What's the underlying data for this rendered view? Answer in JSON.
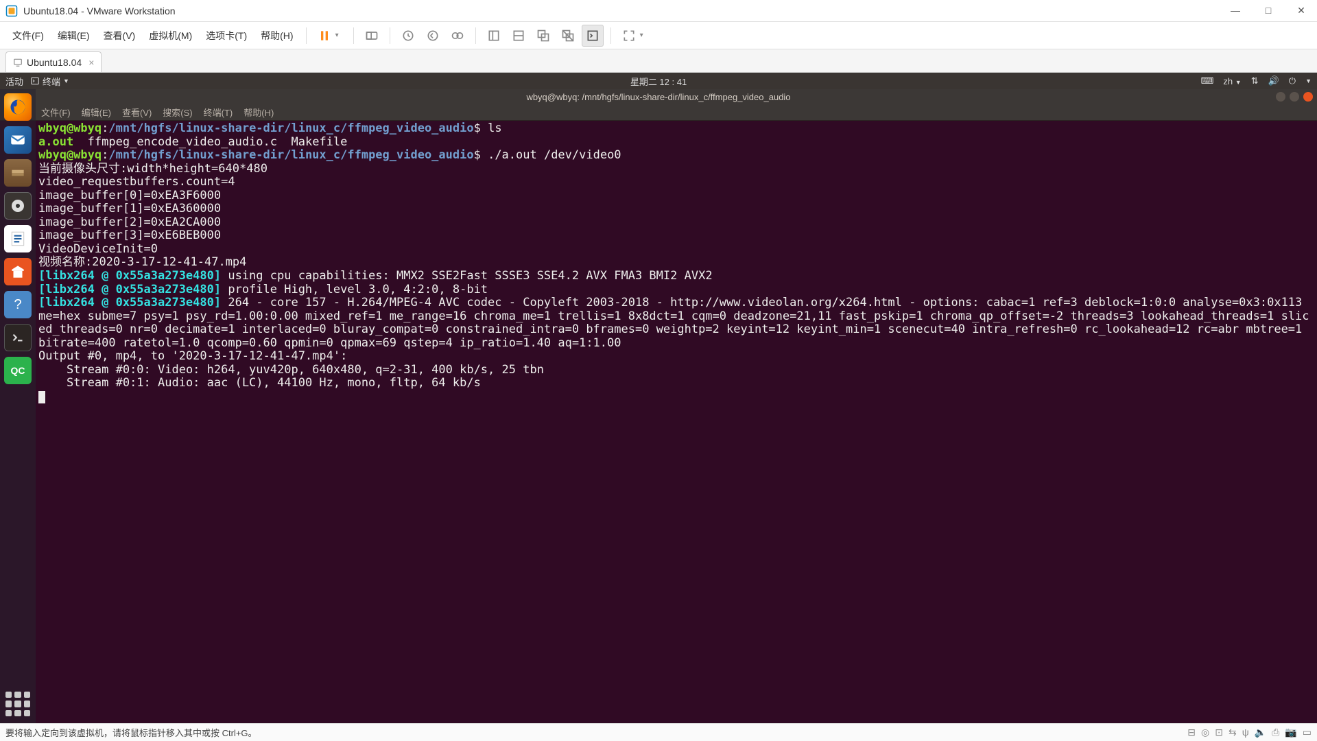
{
  "vmware": {
    "title": "Ubuntu18.04 - VMware Workstation",
    "menu": [
      "文件(F)",
      "编辑(E)",
      "查看(V)",
      "虚拟机(M)",
      "选项卡(T)",
      "帮助(H)"
    ],
    "tab": "Ubuntu18.04",
    "status": "要将输入定向到该虚拟机，请将鼠标指针移入其中或按 Ctrl+G。"
  },
  "ubuntu": {
    "activities": "活动",
    "term_label": "终端",
    "clock": "星期二 12 : 41",
    "lang": "zh",
    "term_title": "wbyq@wbyq: /mnt/hgfs/linux-share-dir/linux_c/ffmpeg_video_audio",
    "term_menu": [
      "文件(F)",
      "编辑(E)",
      "查看(V)",
      "搜索(S)",
      "终端(T)",
      "帮助(H)"
    ]
  },
  "shell": {
    "user": "wbyq@wbyq",
    "path": "/mnt/hgfs/linux-share-dir/linux_c/ffmpeg_video_audio",
    "ls_cmd": "ls",
    "ls_aout": "a.out",
    "ls_cfile": "ffmpeg_encode_video_audio.c",
    "ls_make": "Makefile",
    "run_cmd": "./a.out /dev/video0",
    "dim": "当前摄像头尺寸:width*height=640*480",
    "reqbuf": "video_requestbuffers.count=4",
    "ib0": "image_buffer[0]=0xEA3F6000",
    "ib1": "image_buffer[1]=0xEA360000",
    "ib2": "image_buffer[2]=0xEA2CA000",
    "ib3": "image_buffer[3]=0xE6BEB000",
    "vdi": "VideoDeviceInit=0",
    "vname": "视频名称:2020-3-17-12-41-47.mp4",
    "lx_tag": "[libx264 @ 0x55a3a273e480]",
    "lx1": " using cpu capabilities: MMX2 SSE2Fast SSSE3 SSE4.2 AVX FMA3 BMI2 AVX2",
    "lx2": " profile High, level 3.0, 4:2:0, 8-bit",
    "lx3": " 264 - core 157 - H.264/MPEG-4 AVC codec - Copyleft 2003-2018 - http://www.videolan.org/x264.html - options: cabac=1 ref=3 deblock=1:0:0 analyse=0x3:0x113 me=hex subme=7 psy=1 psy_rd=1.00:0.00 mixed_ref=1 me_range=16 chroma_me=1 trellis=1 8x8dct=1 cqm=0 deadzone=21,11 fast_pskip=1 chroma_qp_offset=-2 threads=3 lookahead_threads=1 sliced_threads=0 nr=0 decimate=1 interlaced=0 bluray_compat=0 constrained_intra=0 bframes=0 weightp=2 keyint=12 keyint_min=1 scenecut=40 intra_refresh=0 rc_lookahead=12 rc=abr mbtree=1 bitrate=400 ratetol=1.0 qcomp=0.60 qpmin=0 qpmax=69 qstep=4 ip_ratio=1.40 aq=1:1.00",
    "out0": "Output #0, mp4, to '2020-3-17-12-41-47.mp4':",
    "str0": "    Stream #0:0: Video: h264, yuv420p, 640x480, q=2-31, 400 kb/s, 25 tbn",
    "str1": "    Stream #0:1: Audio: aac (LC), 44100 Hz, mono, fltp, 64 kb/s"
  }
}
